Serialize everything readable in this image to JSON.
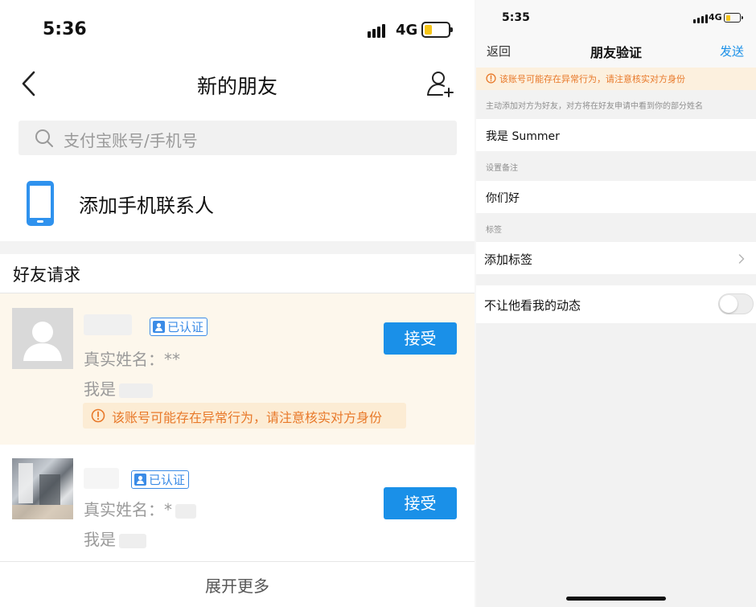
{
  "left": {
    "status": {
      "time": "5:36",
      "network": "4G"
    },
    "nav": {
      "title": "新的朋友"
    },
    "search": {
      "placeholder": "支付宝账号/手机号"
    },
    "contacts": {
      "label": "添加手机联系人"
    },
    "requests_header": "好友请求",
    "requests": [
      {
        "badge": "已认证",
        "real_name_label": "真实姓名：",
        "real_name_value": "**",
        "message_prefix": "我是",
        "accept_label": "接受",
        "warning": "该账号可能存在异常行为，请注意核实对方身份"
      },
      {
        "badge": "已认证",
        "real_name_label": "真实姓名：",
        "real_name_value": "*",
        "message_prefix": "我是",
        "accept_label": "接受"
      }
    ],
    "more_label": "展开更多"
  },
  "right": {
    "status": {
      "time": "5:35",
      "network": "4G"
    },
    "nav": {
      "back_label": "返回",
      "title": "朋友验证",
      "send_label": "发送"
    },
    "warning": "该账号可能存在异常行为，请注意核实对方身份",
    "hint": "主动添加对方为好友，对方将在好友申请中看到你的部分姓名",
    "greeting_value": "我是 Summer",
    "remark_caption": "设置备注",
    "remark_value": "你们好",
    "tags_caption": "标签",
    "add_tag_label": "添加标签",
    "privacy_label": "不让他看我的动态",
    "privacy_enabled": false
  },
  "colors": {
    "accent": "#1a90e8",
    "warning": "#e8792a",
    "request_highlight": "#fdf7ec",
    "battery": "#f5c518"
  }
}
